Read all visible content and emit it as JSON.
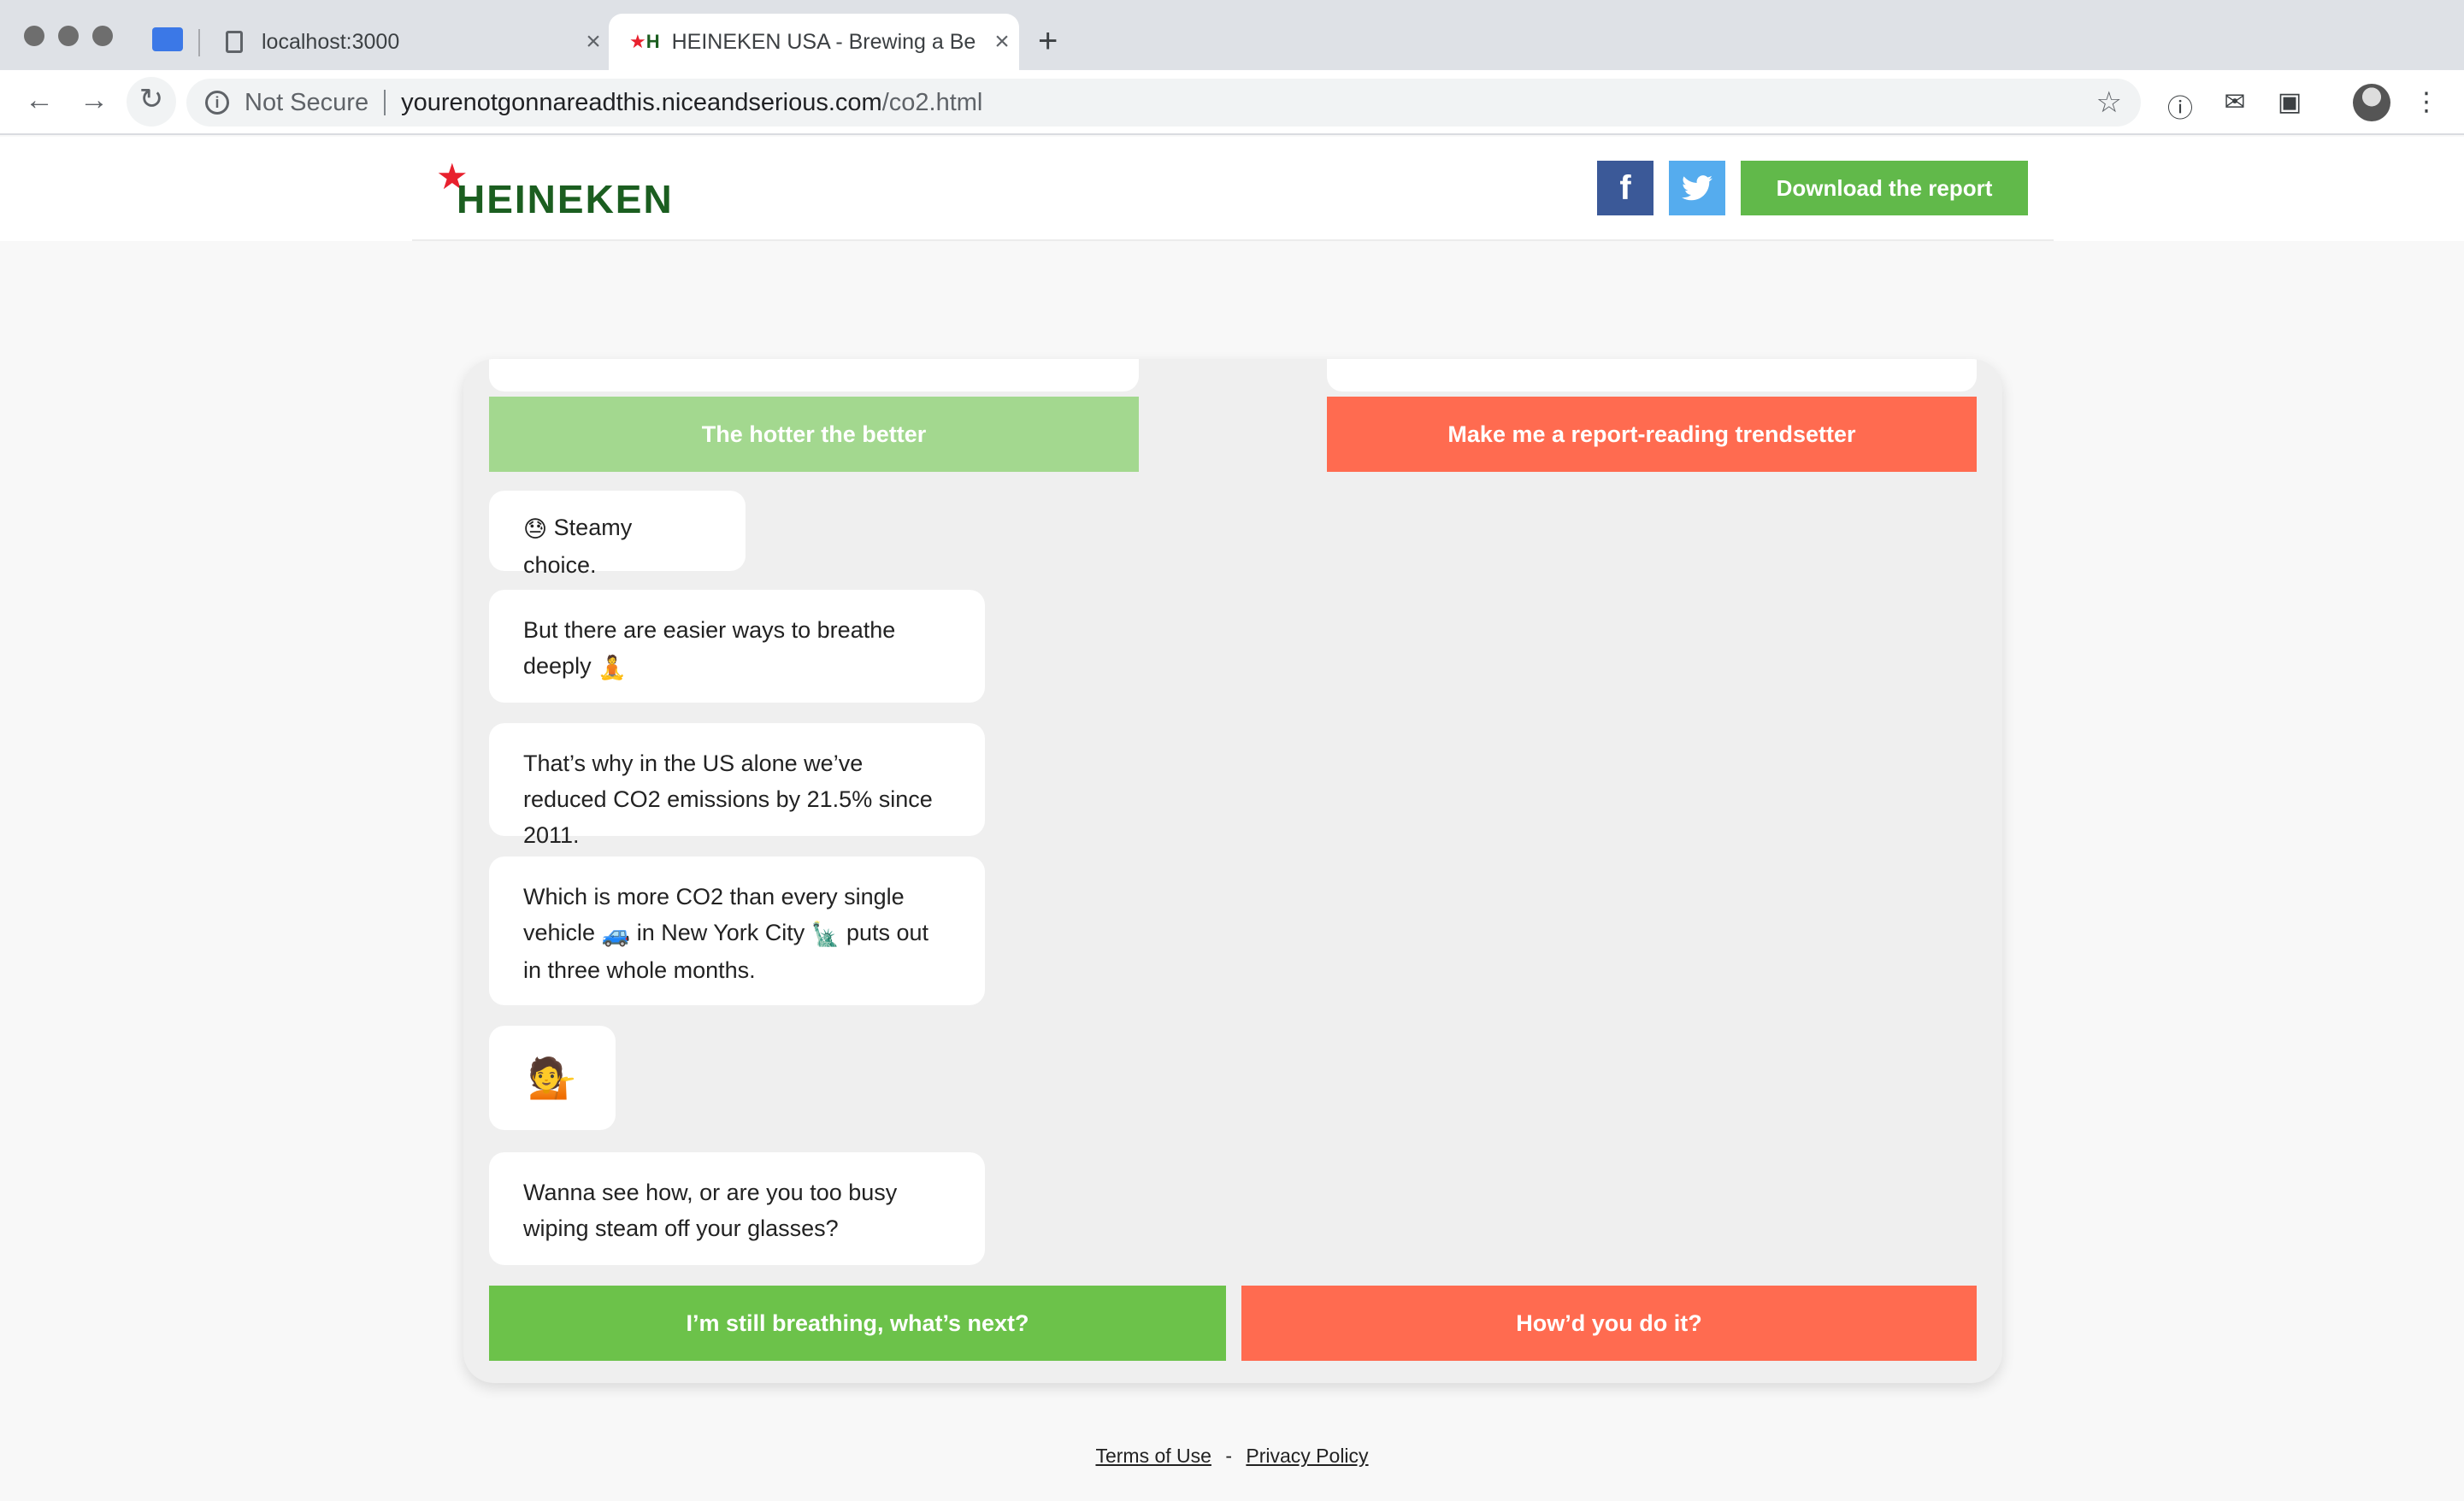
{
  "browser": {
    "tabs": [
      {
        "label": "localhost:3000",
        "active": false
      },
      {
        "label": "HEINEKEN USA - Brewing a Be",
        "active": true
      }
    ],
    "address": {
      "security_label": "Not Secure",
      "host": "yourenotgonnareadthis.niceandserious.com",
      "path": "/co2.html"
    },
    "icons": [
      "back-icon",
      "forward-icon",
      "reload-icon",
      "star-icon",
      "onepassword-icon",
      "mail-icon",
      "screenshot-icon",
      "profile-avatar",
      "menu-icon"
    ]
  },
  "header": {
    "logo_text": "HEINEKEN",
    "download_label": "Download the report",
    "facebook_glyph": "f",
    "brand_green": "#61b94a",
    "brand_red": "#e8212e"
  },
  "chat": {
    "top_choices": [
      {
        "label": "The hotter the better",
        "color": "#a3d88f"
      },
      {
        "label": "Make me a report-reading trendsetter",
        "color": "#ff6b50"
      }
    ],
    "messages": [
      {
        "emoji": "😓",
        "text": "Steamy choice."
      },
      {
        "text": "But there are easier ways to breathe deeply",
        "emoji": "🧘"
      },
      {
        "text": "That’s why in the US alone we’ve reduced CO2 emissions by 21.5% since 2011."
      },
      {
        "text_a": "Which is more CO2 than every single vehicle",
        "emoji_a": "🚙",
        "text_b": "in New York City",
        "emoji_b": "🗽",
        "text_c": "puts out in three whole months."
      },
      {
        "emoji": "💁"
      },
      {
        "text": "Wanna see how, or are you too busy wiping steam off your glasses?"
      }
    ],
    "bottom_choices": [
      {
        "label": "I’m still breathing, what’s next?",
        "color": "#6cc24a"
      },
      {
        "label": "How’d you do it?",
        "color": "#ff6b50"
      }
    ]
  },
  "footer": {
    "terms": "Terms of Use",
    "separator": "-",
    "privacy": "Privacy Policy"
  }
}
